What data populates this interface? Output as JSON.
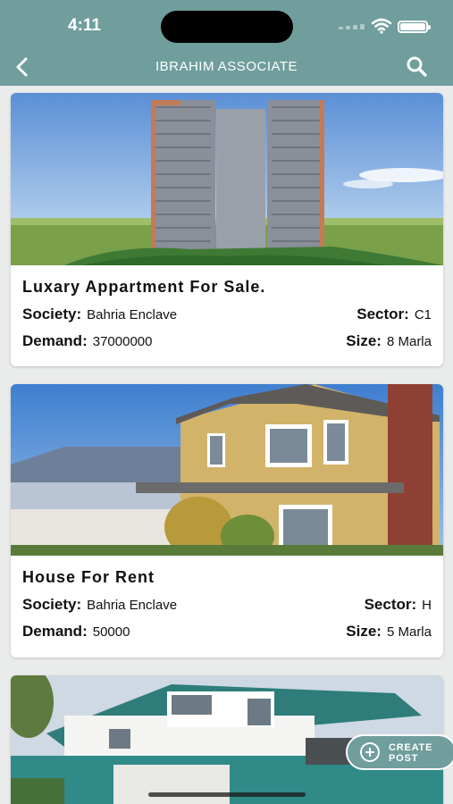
{
  "status_bar": {
    "time": "4:11"
  },
  "header": {
    "title": "IBRAHIM ASSOCIATE",
    "back_icon": "chevron-left-icon",
    "search_icon": "search-icon"
  },
  "listings": [
    {
      "title": "Luxary Appartment For Sale.",
      "society_label": "Society:",
      "society": "Bahria Enclave",
      "sector_label": "Sector:",
      "sector": "C1",
      "demand_label": "Demand:",
      "demand": "37000000",
      "size_label": "Size:",
      "size": "8 Marla"
    },
    {
      "title": "House For Rent",
      "society_label": "Society:",
      "society": "Bahria Enclave",
      "sector_label": "Sector:",
      "sector": "H",
      "demand_label": "Demand:",
      "demand": "50000",
      "size_label": "Size:",
      "size": "5 Marla"
    }
  ],
  "create_post": {
    "line1": "CREATE",
    "line2": "POST"
  },
  "colors": {
    "header": "#6f9e9c",
    "background": "#eaecec"
  }
}
